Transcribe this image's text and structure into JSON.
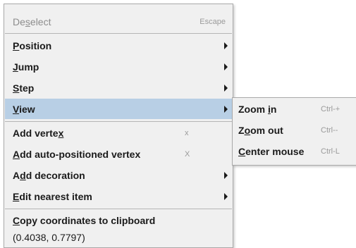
{
  "menu": {
    "deselect": {
      "pre": "De",
      "mnemonic": "s",
      "post": "elect",
      "accel": "Escape"
    },
    "position": {
      "pre": "",
      "mnemonic": "P",
      "post": "osition"
    },
    "jump": {
      "pre": "",
      "mnemonic": "J",
      "post": "ump"
    },
    "step": {
      "pre": "",
      "mnemonic": "S",
      "post": "tep"
    },
    "view": {
      "pre": "",
      "mnemonic": "V",
      "post": "iew"
    },
    "add_vertex": {
      "pre": "Add verte",
      "mnemonic": "x",
      "post": "",
      "accel": "x"
    },
    "add_auto_vertex": {
      "pre": "",
      "mnemonic": "A",
      "post": "dd auto-positioned vertex",
      "accel": "X"
    },
    "add_decoration": {
      "pre": "A",
      "mnemonic": "d",
      "post": "d decoration"
    },
    "edit_nearest": {
      "pre": "",
      "mnemonic": "E",
      "post": "dit nearest item"
    },
    "copy_coords": {
      "pre": "",
      "mnemonic": "C",
      "post": "opy coordinates to clipboard"
    },
    "coords_value": "(0.4038, 0.7797)"
  },
  "submenu": {
    "zoom_in": {
      "pre": "Zoom ",
      "mnemonic": "i",
      "post": "n",
      "accel": "Ctrl-+"
    },
    "zoom_out": {
      "pre": "Z",
      "mnemonic": "o",
      "post": "om out",
      "accel": "Ctrl--"
    },
    "center_mouse": {
      "pre": "",
      "mnemonic": "C",
      "post": "enter mouse",
      "accel": "Ctrl-L"
    }
  },
  "colors": {
    "menu_bg": "#f0f0f0",
    "highlight": "#b8cfe5",
    "disabled": "#8d8d8d"
  }
}
